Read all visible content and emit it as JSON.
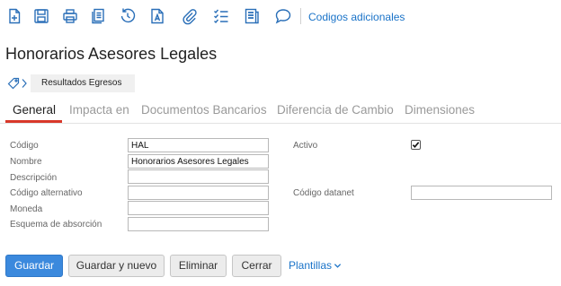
{
  "toolbar": {
    "icons": [
      "new-document-icon",
      "save-icon",
      "print-icon",
      "copy-icon",
      "history-icon",
      "font-document-icon",
      "attachment-icon",
      "checklist-icon",
      "notes-icon",
      "comment-icon"
    ],
    "link_label": "Codigos adicionales",
    "accent": "#1a73c8"
  },
  "page": {
    "title": "Honorarios Asesores Legales"
  },
  "breadcrumb": {
    "items": [
      "Resultados Egresos"
    ]
  },
  "tabs": [
    {
      "label": "General",
      "active": true
    },
    {
      "label": "Impacta en",
      "active": false
    },
    {
      "label": "Documentos Bancarios",
      "active": false
    },
    {
      "label": "Diferencia de Cambio",
      "active": false
    },
    {
      "label": "Dimensiones",
      "active": false
    }
  ],
  "form": {
    "codigo": {
      "label": "Código",
      "value": "HAL"
    },
    "nombre": {
      "label": "Nombre",
      "value": "Honorarios Asesores Legales"
    },
    "descripcion": {
      "label": "Descripción",
      "value": ""
    },
    "codigo_alternativo": {
      "label": "Código alternativo",
      "value": ""
    },
    "moneda": {
      "label": "Moneda",
      "value": ""
    },
    "esquema": {
      "label": "Esquema de absorción",
      "value": ""
    },
    "activo": {
      "label": "Activo",
      "checked": true
    },
    "codigo_datanet": {
      "label": "Código datanet",
      "value": ""
    }
  },
  "actions": {
    "save": "Guardar",
    "save_new": "Guardar y nuevo",
    "delete": "Eliminar",
    "close": "Cerrar",
    "templates": "Plantillas"
  },
  "colors": {
    "primary_button": "#3b89dd",
    "tab_underline": "#d9382a"
  }
}
